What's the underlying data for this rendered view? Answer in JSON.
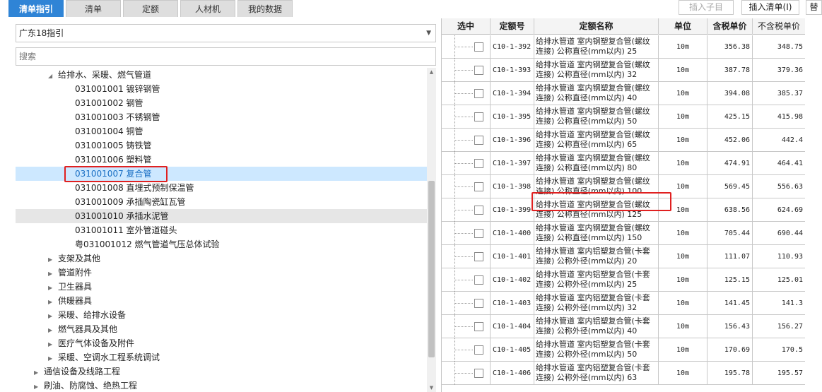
{
  "tabs": [
    "清单指引",
    "清单",
    "定额",
    "人材机",
    "我的数据"
  ],
  "left": {
    "dropdown_value": "广东18指引",
    "search_placeholder": "搜索",
    "tree": [
      {
        "label": "给排水、采暖、燃气管道",
        "caret": "expanded",
        "state": ""
      },
      {
        "label": "031001001  镀锌钢管",
        "caret": "",
        "state": ""
      },
      {
        "label": "031001002  钢管",
        "caret": "",
        "state": ""
      },
      {
        "label": "031001003  不锈钢管",
        "caret": "",
        "state": ""
      },
      {
        "label": "031001004  铜管",
        "caret": "",
        "state": ""
      },
      {
        "label": "031001005  铸铁管",
        "caret": "",
        "state": ""
      },
      {
        "label": "031001006  塑料管",
        "caret": "",
        "state": ""
      },
      {
        "label": "031001007  复合管",
        "caret": "",
        "state": "selected"
      },
      {
        "label": "031001008  直埋式预制保温管",
        "caret": "",
        "state": ""
      },
      {
        "label": "031001009  承插陶瓷缸瓦管",
        "caret": "",
        "state": ""
      },
      {
        "label": "031001010  承插水泥管",
        "caret": "",
        "state": "hover"
      },
      {
        "label": "031001011  室外管道碰头",
        "caret": "",
        "state": ""
      },
      {
        "label": "粤031001012  燃气管道气压总体试验",
        "caret": "",
        "state": ""
      },
      {
        "label": "支架及其他",
        "caret": "collapsed",
        "state": ""
      },
      {
        "label": "管道附件",
        "caret": "collapsed",
        "state": ""
      },
      {
        "label": "卫生器具",
        "caret": "collapsed",
        "state": ""
      },
      {
        "label": "供暖器具",
        "caret": "collapsed",
        "state": ""
      },
      {
        "label": "采暖、给排水设备",
        "caret": "collapsed",
        "state": ""
      },
      {
        "label": "燃气器具及其他",
        "caret": "collapsed",
        "state": ""
      },
      {
        "label": "医疗气体设备及附件",
        "caret": "collapsed",
        "state": ""
      },
      {
        "label": "采暖、空调水工程系统调试",
        "caret": "collapsed",
        "state": ""
      },
      {
        "label": "通信设备及线路工程",
        "caret": "collapsed",
        "state": ""
      },
      {
        "label": "刷油、防腐蚀、绝热工程",
        "caret": "collapsed",
        "state": ""
      }
    ]
  },
  "toolbar": {
    "insert_sub": "插入子目",
    "insert_list": "插入清单(I)",
    "replace": "替"
  },
  "table": {
    "headers": [
      "选中",
      "定额号",
      "定额名称",
      "单位",
      "含税单价",
      "不含税单价"
    ],
    "rows": [
      {
        "code": "C10-1-392",
        "name": "给排水管道 室内钢塑复合管(螺纹连接) 公称直径(mm以内) 25",
        "unit": "10m",
        "price_tax": "356.38",
        "price_notax": "348.75"
      },
      {
        "code": "C10-1-393",
        "name": "给排水管道 室内钢塑复合管(螺纹连接) 公称直径(mm以内) 32",
        "unit": "10m",
        "price_tax": "387.78",
        "price_notax": "379.36"
      },
      {
        "code": "C10-1-394",
        "name": "给排水管道 室内钢塑复合管(螺纹连接) 公称直径(mm以内) 40",
        "unit": "10m",
        "price_tax": "394.08",
        "price_notax": "385.37"
      },
      {
        "code": "C10-1-395",
        "name": "给排水管道 室内钢塑复合管(螺纹连接) 公称直径(mm以内) 50",
        "unit": "10m",
        "price_tax": "425.15",
        "price_notax": "415.98"
      },
      {
        "code": "C10-1-396",
        "name": "给排水管道 室内钢塑复合管(螺纹连接) 公称直径(mm以内) 65",
        "unit": "10m",
        "price_tax": "452.06",
        "price_notax": "442.4"
      },
      {
        "code": "C10-1-397",
        "name": "给排水管道 室内钢塑复合管(螺纹连接) 公称直径(mm以内) 80",
        "unit": "10m",
        "price_tax": "474.91",
        "price_notax": "464.41"
      },
      {
        "code": "C10-1-398",
        "name": "给排水管道 室内钢塑复合管(螺纹连接) 公称直径(mm以内) 100",
        "unit": "10m",
        "price_tax": "569.45",
        "price_notax": "556.63"
      },
      {
        "code": "C10-1-399",
        "name": "给排水管道 室内钢塑复合管(螺纹连接) 公称直径(mm以内) 125",
        "unit": "10m",
        "price_tax": "638.56",
        "price_notax": "624.69"
      },
      {
        "code": "C10-1-400",
        "name": "给排水管道 室内钢塑复合管(螺纹连接) 公称直径(mm以内) 150",
        "unit": "10m",
        "price_tax": "705.44",
        "price_notax": "690.44"
      },
      {
        "code": "C10-1-401",
        "name": "给排水管道 室内铝塑复合管(卡套连接) 公称外径(mm以内) 20",
        "unit": "10m",
        "price_tax": "111.07",
        "price_notax": "110.93"
      },
      {
        "code": "C10-1-402",
        "name": "给排水管道 室内铝塑复合管(卡套连接) 公称外径(mm以内) 25",
        "unit": "10m",
        "price_tax": "125.15",
        "price_notax": "125.01"
      },
      {
        "code": "C10-1-403",
        "name": "给排水管道 室内铝塑复合管(卡套连接) 公称外径(mm以内) 32",
        "unit": "10m",
        "price_tax": "141.45",
        "price_notax": "141.3"
      },
      {
        "code": "C10-1-404",
        "name": "给排水管道 室内铝塑复合管(卡套连接) 公称外径(mm以内) 40",
        "unit": "10m",
        "price_tax": "156.43",
        "price_notax": "156.27"
      },
      {
        "code": "C10-1-405",
        "name": "给排水管道 室内铝塑复合管(卡套连接) 公称外径(mm以内) 50",
        "unit": "10m",
        "price_tax": "170.69",
        "price_notax": "170.5"
      },
      {
        "code": "C10-1-406",
        "name": "给排水管道 室内铝塑复合管(卡套连接) 公称外径(mm以内) 63",
        "unit": "10m",
        "price_tax": "195.78",
        "price_notax": "195.57"
      }
    ]
  },
  "colors": {
    "accent": "#2f84d6",
    "selection": "#cde8ff",
    "annotation": "#e02020"
  }
}
